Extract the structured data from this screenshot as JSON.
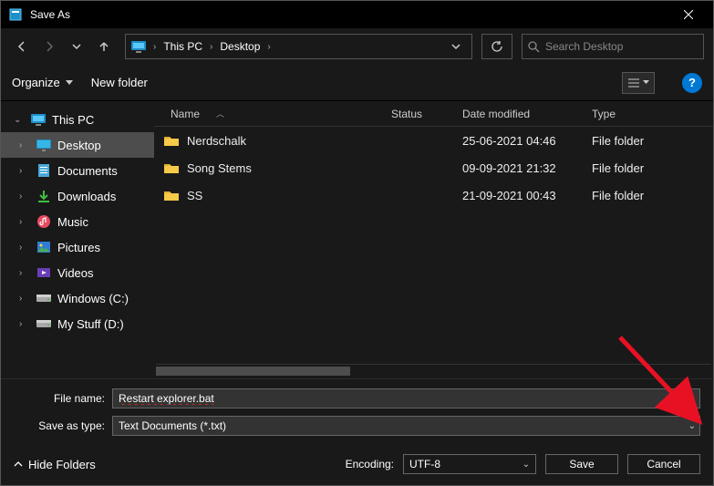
{
  "title": "Save As",
  "breadcrumbs": [
    "This PC",
    "Desktop"
  ],
  "search_placeholder": "Search Desktop",
  "toolbar": {
    "organize": "Organize",
    "newfolder": "New folder"
  },
  "sidebar": [
    {
      "label": "This PC",
      "icon": "pc",
      "expanded": true,
      "level": 0
    },
    {
      "label": "Desktop",
      "icon": "desktop",
      "selected": true,
      "level": 1
    },
    {
      "label": "Documents",
      "icon": "documents",
      "level": 1
    },
    {
      "label": "Downloads",
      "icon": "downloads",
      "level": 1
    },
    {
      "label": "Music",
      "icon": "music",
      "level": 1
    },
    {
      "label": "Pictures",
      "icon": "pictures",
      "level": 1
    },
    {
      "label": "Videos",
      "icon": "videos",
      "level": 1
    },
    {
      "label": "Windows (C:)",
      "icon": "drive",
      "level": 1
    },
    {
      "label": "My Stuff (D:)",
      "icon": "drive",
      "level": 1
    }
  ],
  "columns": {
    "name": "Name",
    "status": "Status",
    "date": "Date modified",
    "type": "Type"
  },
  "files": [
    {
      "name": "Nerdschalk",
      "date": "25-06-2021 04:46",
      "type": "File folder"
    },
    {
      "name": "Song Stems",
      "date": "09-09-2021 21:32",
      "type": "File folder"
    },
    {
      "name": "SS",
      "date": "21-09-2021 00:43",
      "type": "File folder"
    }
  ],
  "filename_label": "File name:",
  "filename_value": "Restart explorer.bat",
  "savetype_label": "Save as type:",
  "savetype_value": "Text Documents (*.txt)",
  "hide_folders": "Hide Folders",
  "encoding_label": "Encoding:",
  "encoding_value": "UTF-8",
  "save_label": "Save",
  "cancel_label": "Cancel"
}
